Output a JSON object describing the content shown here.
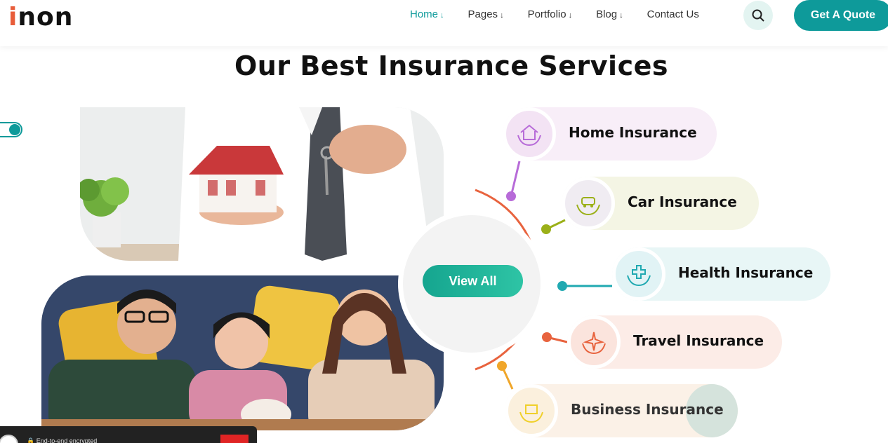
{
  "header": {
    "logo_text": "non",
    "logo_letter": "i",
    "nav": [
      {
        "label": "Home",
        "arrow": "↓",
        "active": true
      },
      {
        "label": "Pages",
        "arrow": "↓"
      },
      {
        "label": "Portfolio",
        "arrow": "↓"
      },
      {
        "label": "Blog",
        "arrow": "↓"
      },
      {
        "label": "Contact Us",
        "arrow": ""
      }
    ],
    "search_icon": "search-icon",
    "quote_label": "Get A Quote"
  },
  "main": {
    "title": "Our Best Insurance Services",
    "view_all_label": "View All",
    "services": [
      {
        "label": "Home Insurance",
        "icon": "home-hands-icon",
        "color": "#b76bd8",
        "bg": "#f8eef8"
      },
      {
        "label": "Car Insurance",
        "icon": "car-hands-icon",
        "color": "#9bb019",
        "bg": "#f4f5e4"
      },
      {
        "label": "Health Insurance",
        "icon": "health-hands-icon",
        "color": "#20a9b1",
        "bg": "#e8f6f6"
      },
      {
        "label": "Travel Insurance",
        "icon": "travel-hands-icon",
        "color": "#e8633e",
        "bg": "#fcece7"
      },
      {
        "label": "Business Insurance",
        "icon": "business-hands-icon",
        "color": "#f0a62a",
        "bg": "#fbf1e7"
      }
    ]
  },
  "chat": {
    "text": "End-to-end encrypted"
  },
  "colors": {
    "accent": "#0e9a9a",
    "arc": "#e8633e"
  }
}
